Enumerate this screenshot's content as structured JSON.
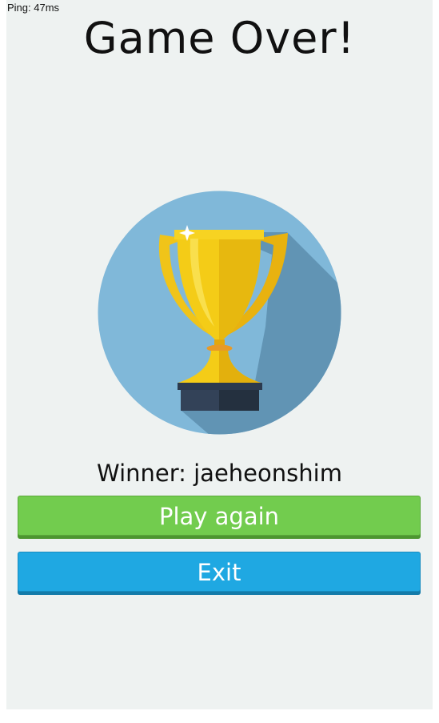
{
  "status": {
    "ping": "Ping: 47ms"
  },
  "header": {
    "title": "Game Over!"
  },
  "result": {
    "winner_text": "Winner: jaeheonshim"
  },
  "actions": {
    "play_again_label": "Play again",
    "exit_label": "Exit"
  },
  "colors": {
    "background": "#eef2f1",
    "play_again": "#72cc4e",
    "exit": "#1fa8e2",
    "trophy_circle": "#7fb7d8",
    "trophy_gold": "#f2c413"
  },
  "icons": {
    "trophy": "trophy-icon"
  }
}
